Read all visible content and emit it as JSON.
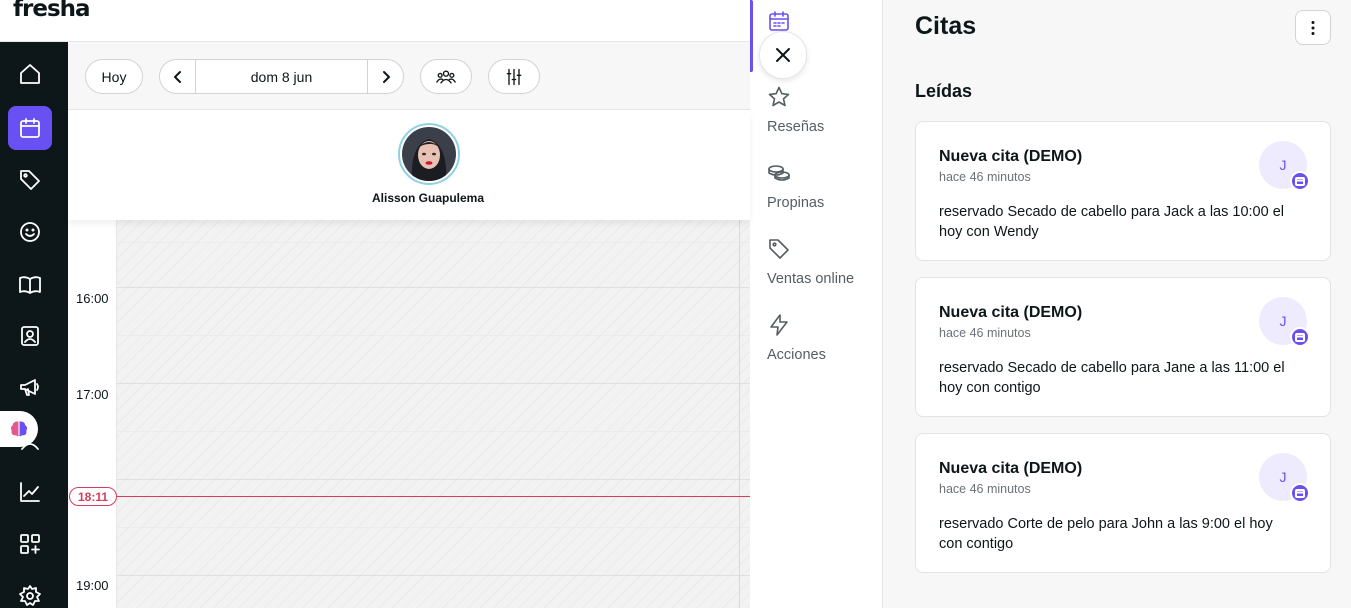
{
  "app": {
    "logo": "fresha"
  },
  "left_nav": {
    "items": [
      {
        "name": "home-icon"
      },
      {
        "name": "calendar-icon",
        "active": true
      },
      {
        "name": "tag-icon"
      },
      {
        "name": "smile-icon"
      },
      {
        "name": "book-icon"
      },
      {
        "name": "contact-card-icon"
      },
      {
        "name": "megaphone-icon"
      },
      {
        "name": "team-icon"
      },
      {
        "name": "chart-icon"
      },
      {
        "name": "add-apps-icon"
      },
      {
        "name": "settings-icon"
      }
    ]
  },
  "toolbar": {
    "today_label": "Hoy",
    "date_label": "dom 8 jun"
  },
  "staff": {
    "name": "Alisson Guapulema"
  },
  "timeline": {
    "labels": [
      "16:00",
      "17:00",
      "19:00"
    ],
    "now": "18:11"
  },
  "categories": {
    "items": [
      {
        "label": "Citas",
        "icon": "calendar-icon",
        "active": true
      },
      {
        "label": "Reseñas",
        "icon": "star-icon"
      },
      {
        "label": "Propinas",
        "icon": "coins-icon"
      },
      {
        "label": "Ventas online",
        "icon": "tag-icon"
      },
      {
        "label": "Acciones",
        "icon": "lightning-icon"
      }
    ]
  },
  "notifications": {
    "title": "Citas",
    "section": "Leídas",
    "cards": [
      {
        "title": "Nueva cita (DEMO)",
        "time": "hace 46 minutos",
        "body": "reservado Secado de cabello para Jack a las 10:00 el hoy con Wendy",
        "avatar": "J"
      },
      {
        "title": "Nueva cita (DEMO)",
        "time": "hace 46 minutos",
        "body": "reservado Secado de cabello para Jane a las 11:00 el hoy con contigo",
        "avatar": "J"
      },
      {
        "title": "Nueva cita (DEMO)",
        "time": "hace 46 minutos",
        "body": "reservado Corte de pelo para John a las 9:00 el hoy con contigo",
        "avatar": "J"
      }
    ]
  },
  "colors": {
    "accent": "#6950f3",
    "now_line": "#d63d5c",
    "sidebar": "#0d1619"
  }
}
